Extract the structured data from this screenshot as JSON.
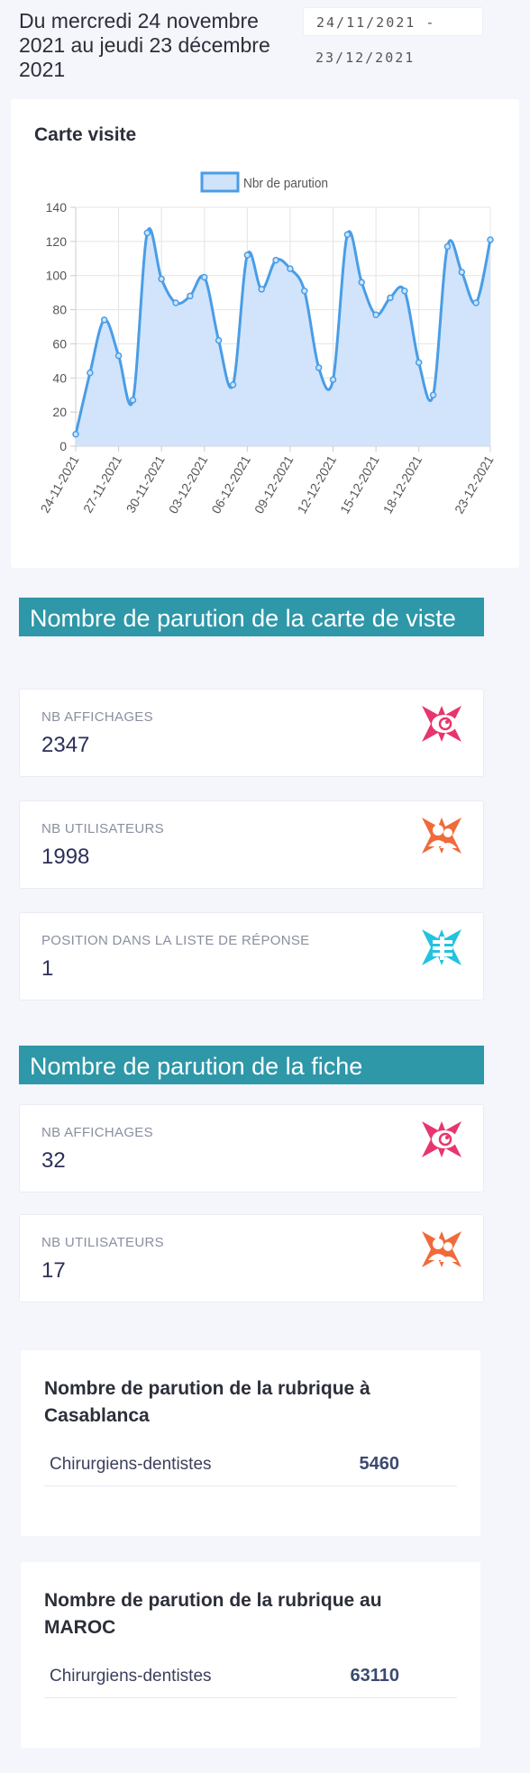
{
  "header": {
    "range_text": "Du mercredi 24 novembre 2021 au jeudi 23 décembre 2021",
    "date_input_line1": "24/11/2021 -",
    "date_input_line2": "23/12/2021"
  },
  "chart_card": {
    "title": "Carte visite"
  },
  "chart_data": {
    "type": "line",
    "title": "",
    "legend": "Nbr de parution",
    "legend_position": "top",
    "xlabel": "",
    "ylabel": "",
    "ylim": [
      0,
      140
    ],
    "yticks": [
      0,
      20,
      40,
      60,
      80,
      100,
      120,
      140
    ],
    "grid": true,
    "line_color": "#4a9de6",
    "fill_color": "#cfe3fb",
    "x": [
      "24-11-2021",
      "25-11-2021",
      "26-11-2021",
      "27-11-2021",
      "28-11-2021",
      "29-11-2021",
      "30-11-2021",
      "01-12-2021",
      "02-12-2021",
      "03-12-2021",
      "04-12-2021",
      "05-12-2021",
      "06-12-2021",
      "07-12-2021",
      "08-12-2021",
      "09-12-2021",
      "10-12-2021",
      "11-12-2021",
      "12-12-2021",
      "13-12-2021",
      "14-12-2021",
      "15-12-2021",
      "16-12-2021",
      "17-12-2021",
      "18-12-2021",
      "19-12-2021",
      "20-12-2021",
      "21-12-2021",
      "22-12-2021",
      "23-12-2021"
    ],
    "xtick_labels": [
      "24-11-2021",
      "27-11-2021",
      "30-11-2021",
      "03-12-2021",
      "06-12-2021",
      "09-12-2021",
      "12-12-2021",
      "15-12-2021",
      "18-12-2021",
      "23-12-2021"
    ],
    "values": [
      7,
      43,
      74,
      53,
      27,
      125,
      98,
      84,
      88,
      99,
      62,
      36,
      112,
      92,
      109,
      104,
      91,
      46,
      39,
      124,
      96,
      77,
      87,
      91,
      49,
      30,
      117,
      102,
      84,
      121
    ]
  },
  "sections": [
    {
      "title": "Nombre de parution de la carte de viste",
      "stats": [
        {
          "label": "NB AFFICHAGES",
          "value": "2347",
          "icon": "eye-icon",
          "color": "#e8356d"
        },
        {
          "label": "NB UTILISATEURS",
          "value": "1998",
          "icon": "users-icon",
          "color": "#f06a3a"
        },
        {
          "label": "POSITION DANS LA LISTE DE RÉPONSE",
          "value": "1",
          "icon": "list-icon",
          "color": "#22c3e0"
        }
      ]
    },
    {
      "title": "Nombre de parution de la fiche",
      "stats": [
        {
          "label": "NB AFFICHAGES",
          "value": "32",
          "icon": "eye-icon",
          "color": "#e8356d"
        },
        {
          "label": "NB UTILISATEURS",
          "value": "17",
          "icon": "users-icon",
          "color": "#f06a3a"
        }
      ]
    }
  ],
  "rubriques": [
    {
      "title": "Nombre de parution de la rubrique à Casablanca",
      "name": "Chirurgiens-dentistes",
      "value": "5460"
    },
    {
      "title": "Nombre de parution de la rubrique au MAROC",
      "name": "Chirurgiens-dentistes",
      "value": "63110"
    }
  ]
}
